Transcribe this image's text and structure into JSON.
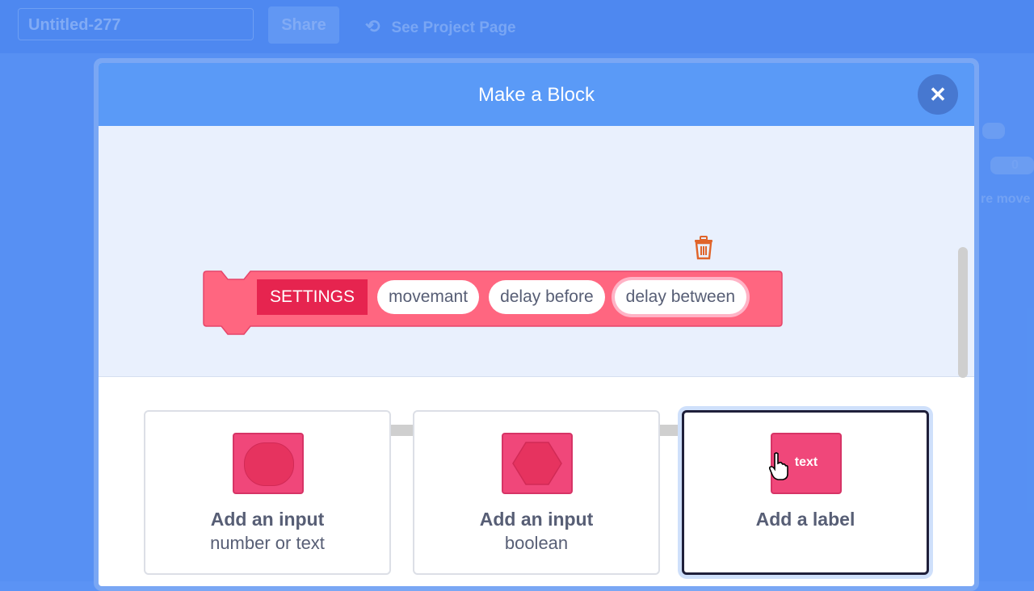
{
  "background": {
    "project_title": "Untitled-277",
    "share_label": "Share",
    "see_project_label": "See Project Page",
    "side_value": "0",
    "side_text": "re move"
  },
  "modal": {
    "title": "Make a Block",
    "close_icon": "close-icon"
  },
  "block": {
    "label": "SETTINGS",
    "inputs": [
      "movemant",
      "delay before",
      "delay between"
    ],
    "color": "#ff6680"
  },
  "options": [
    {
      "title": "Add an input",
      "subtitle": "number or text",
      "icon": "round-input-icon"
    },
    {
      "title": "Add an input",
      "subtitle": "boolean",
      "icon": "boolean-input-icon"
    },
    {
      "title": "Add a label",
      "subtitle": "",
      "icon": "label-icon",
      "icon_text": "text",
      "selected": true
    }
  ],
  "colors": {
    "header": "#5a9af7",
    "block_pink": "#ff6680",
    "accent_red": "#e6244f",
    "trash_orange": "#e0642a"
  }
}
